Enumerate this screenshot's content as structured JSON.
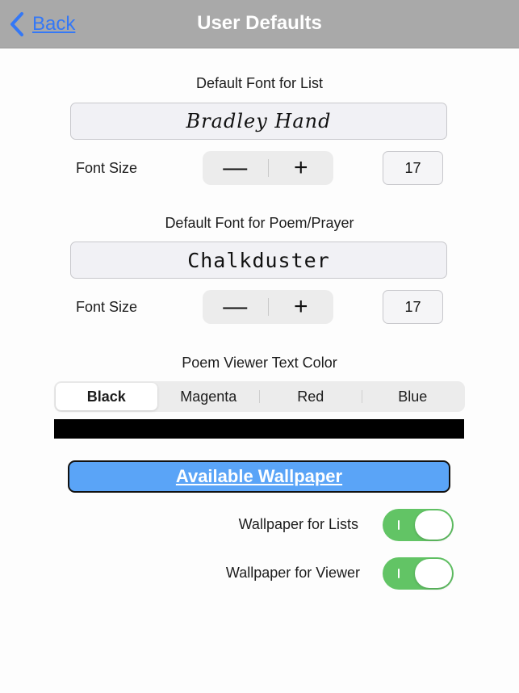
{
  "navbar": {
    "back_label": "Back",
    "title": "User Defaults",
    "back_icon": "chevron-left-icon"
  },
  "list_font": {
    "section_label": "Default Font for List",
    "font_name": "Bradley Hand",
    "size_label": "Font Size",
    "decrement_symbol": "—",
    "increment_symbol": "+",
    "size_value": "17"
  },
  "poem_font": {
    "section_label": "Default Font for Poem/Prayer",
    "font_name": "Chalkduster",
    "size_label": "Font Size",
    "decrement_symbol": "—",
    "increment_symbol": "+",
    "size_value": "17"
  },
  "text_color": {
    "section_label": "Poem Viewer Text Color",
    "options": [
      "Black",
      "Magenta",
      "Red",
      "Blue"
    ],
    "selected": "Black",
    "preview_color": "#000000"
  },
  "wallpaper": {
    "button_label": "Available Wallpaper",
    "button_color": "#5aa4f7",
    "toggles": [
      {
        "label": "Wallpaper for Lists",
        "on": true
      },
      {
        "label": "Wallpaper for Viewer",
        "on": true
      }
    ],
    "toggle_on_color": "#62c465"
  }
}
